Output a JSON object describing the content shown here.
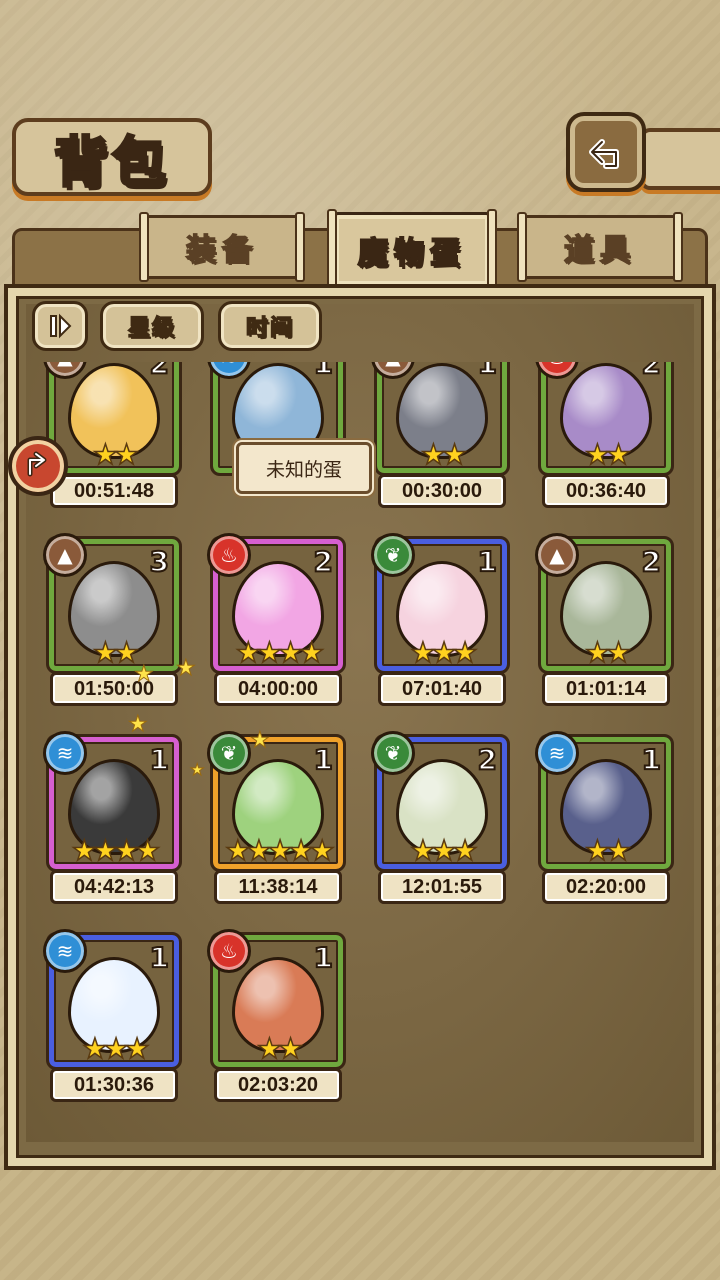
{
  "screen": {
    "title": "背包",
    "back_icon": "back-arrow-icon"
  },
  "tabs": [
    {
      "label": "装备",
      "active": false
    },
    {
      "label": "魔物蛋",
      "active": true
    },
    {
      "label": "道具",
      "active": false
    }
  ],
  "sort": {
    "toggle_icon": "sort-toggle-icon",
    "buttons": [
      "星级",
      "时间"
    ]
  },
  "tooltip": "未知的蛋",
  "colors": {
    "earth": "#8a5a3a",
    "fire": "#d8332a",
    "wood": "#3a8a3a",
    "water": "#2f8fd6",
    "rim_green": "#6fa83e",
    "rim_pink": "#d65fd0",
    "rim_blue": "#4a5ee0",
    "rim_orange": "#f0a12a"
  },
  "eggs": [
    {
      "element": "earth",
      "count": "2",
      "stars": 2,
      "timer": "00:51:48",
      "rim": "rim_green",
      "egg_color": "#f1c25a"
    },
    {
      "element": "water",
      "count": "1",
      "stars": 0,
      "timer": "",
      "rim": "rim_green",
      "egg_color": "#8fb6d8"
    },
    {
      "element": "earth",
      "count": "1",
      "stars": 2,
      "timer": "00:30:00",
      "rim": "rim_green",
      "egg_color": "#7c7f8a"
    },
    {
      "element": "fire",
      "count": "2",
      "stars": 2,
      "timer": "00:36:40",
      "rim": "rim_green",
      "egg_color": "#a88bc8"
    },
    {
      "element": "earth",
      "count": "3",
      "stars": 2,
      "timer": "01:50:00",
      "rim": "rim_green",
      "egg_color": "#8d8d8d"
    },
    {
      "element": "fire",
      "count": "2",
      "stars": 4,
      "timer": "04:00:00",
      "rim": "rim_pink",
      "egg_color": "#f2a6e4"
    },
    {
      "element": "wood",
      "count": "1",
      "stars": 3,
      "timer": "07:01:40",
      "rim": "rim_blue",
      "egg_color": "#f6d3df"
    },
    {
      "element": "earth",
      "count": "2",
      "stars": 2,
      "timer": "01:01:14",
      "rim": "rim_green",
      "egg_color": "#a9b79a"
    },
    {
      "element": "water",
      "count": "1",
      "stars": 4,
      "timer": "04:42:13",
      "rim": "rim_pink",
      "egg_color": "#3a3a3a"
    },
    {
      "element": "wood",
      "count": "1",
      "stars": 5,
      "timer": "11:38:14",
      "rim": "rim_orange",
      "egg_color": "#9ed27e"
    },
    {
      "element": "wood",
      "count": "2",
      "stars": 3,
      "timer": "12:01:55",
      "rim": "rim_blue",
      "egg_color": "#d9e2c5"
    },
    {
      "element": "water",
      "count": "1",
      "stars": 2,
      "timer": "02:20:00",
      "rim": "rim_green",
      "egg_color": "#59608c"
    },
    {
      "element": "water",
      "count": "1",
      "stars": 3,
      "timer": "01:30:36",
      "rim": "rim_blue",
      "egg_color": "#e8f2ff"
    },
    {
      "element": "fire",
      "count": "1",
      "stars": 2,
      "timer": "02:03:20",
      "rim": "rim_green",
      "egg_color": "#d97b56"
    }
  ]
}
